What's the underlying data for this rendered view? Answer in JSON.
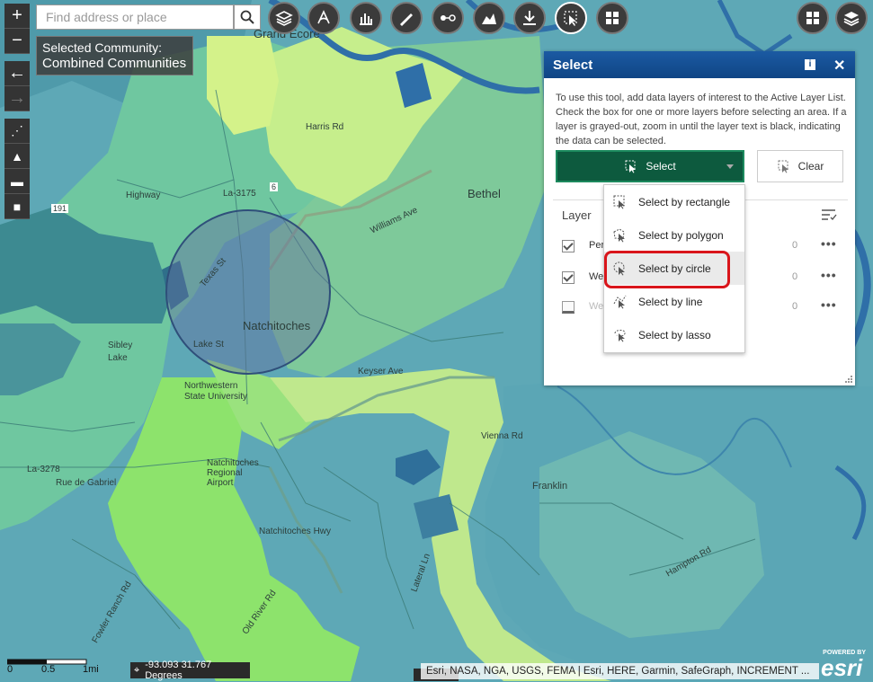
{
  "search": {
    "placeholder": "Find address or place"
  },
  "community": {
    "label": "Selected Community:",
    "value": "Combined Communities"
  },
  "zoom": {
    "in": "+",
    "out": "−"
  },
  "map_labels": {
    "grand_ecore": "Grand Ecore",
    "bethel": "Bethel",
    "natchitoches": "Natchitoches",
    "sibley_lake": "Sibley Lake",
    "nsu": "Northwestern State University",
    "regional": "Natchitoches Regional Airport",
    "keyser": "Keyser Ave",
    "vienna": "Vienna Rd",
    "franklin": "Franklin",
    "hampton": "Hampton Rd",
    "natchitoches_hwy": "Natchitoches Hwy",
    "rue_gabriel": "Rue de Gabriel",
    "fowler": "Fowler Ranch Rd",
    "lateral": "Lateral Ln",
    "williams": "Williams Ave",
    "lake_st": "Lake St",
    "texas_st": "Texas St",
    "highway": "Highway",
    "r6": "6",
    "r191": "191",
    "la3175": "La-3175",
    "la3278": "La-3278",
    "harris": "Harris Rd",
    "old_river": "Old River Rd"
  },
  "panel": {
    "title": "Select",
    "info_icon": "i",
    "close_icon": "✕",
    "instructions": "To use this tool, add data layers of interest to the Active Layer List. Check the box for one or more layers before selecting an area. If a layer is grayed-out, zoom in until the layer text is black, indicating the data can be selected.",
    "select_label": "Select",
    "clear_label": "Clear",
    "layer_header": "Layer",
    "layers": [
      {
        "name": "Per",
        "count": "0",
        "checked": true
      },
      {
        "name": "We",
        "count": "0",
        "checked": true
      },
      {
        "name": "We",
        "count": "0",
        "checked": false
      }
    ]
  },
  "dropdown": {
    "items": [
      {
        "label": "Select by rectangle"
      },
      {
        "label": "Select by polygon"
      },
      {
        "label": "Select by circle"
      },
      {
        "label": "Select by line"
      },
      {
        "label": "Select by lasso"
      }
    ]
  },
  "scale": {
    "zero": "0",
    "half": "0.5",
    "one": "1mi"
  },
  "coords": "-93.093 31.767 Degrees",
  "attribution": "Esri, NASA, NGA, USGS, FEMA | Esri, HERE, Garmin, SafeGraph, INCREMENT ...",
  "esri": {
    "powered": "POWERED BY",
    "word": "esri"
  },
  "colors": {
    "header": "#0f4585",
    "select_btn": "#0d5a3e",
    "highlight": "#d9151b"
  }
}
